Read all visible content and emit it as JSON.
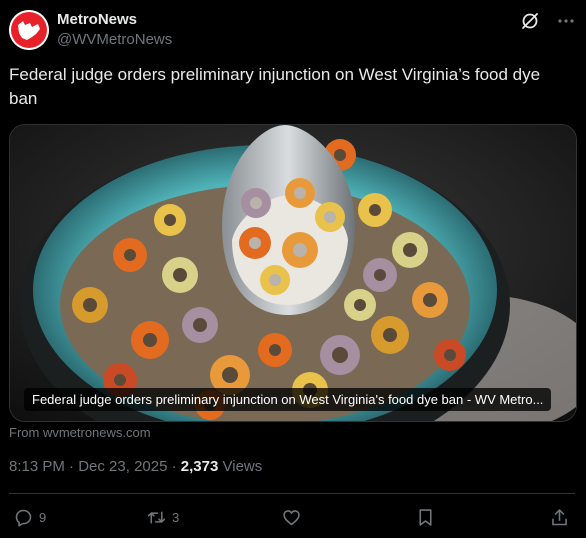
{
  "author": {
    "display_name": "MetroNews",
    "handle": "@WVMetroNews",
    "avatar_icon": "metronews-logo-icon",
    "brand_color": "#e8202a"
  },
  "header_icons": [
    "grok-icon",
    "more-icon"
  ],
  "tweet": {
    "text": "Federal judge orders preliminary injunction on West Virginia’s food dye ban"
  },
  "card": {
    "caption": "Federal judge orders preliminary injunction on West Virginia's food dye ban - WV Metro...",
    "image": "photo of a spoon lifting colorful cereal loops and milk from a turquoise bowl",
    "source": "From wvmetronews.com"
  },
  "meta": {
    "time": "8:13 PM",
    "date": "Dec 23, 2025",
    "views_count": "2,373",
    "views_label": "Views"
  },
  "actions": {
    "reply_icon": "reply-icon",
    "reply_count": "9",
    "retweet_icon": "retweet-icon",
    "retweet_count": "3",
    "like_icon": "heart-icon",
    "bookmark_icon": "bookmark-icon",
    "share_icon": "share-icon"
  },
  "colors": {
    "background": "#000000",
    "text": "#e7e9ea",
    "secondary": "#71767b",
    "border": "#2f3336"
  }
}
